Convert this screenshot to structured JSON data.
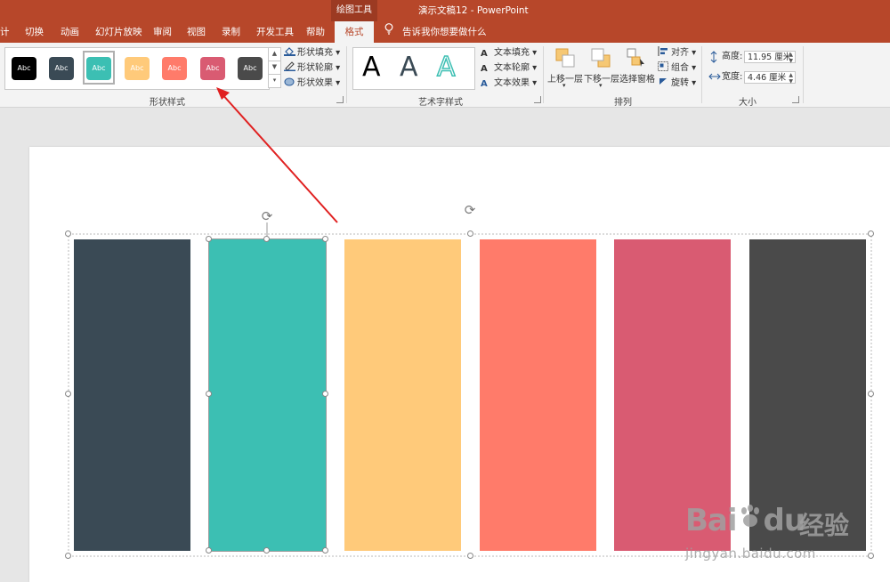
{
  "window": {
    "doc_title": "演示文稿12  -  PowerPoint",
    "context_tool": "绘图工具"
  },
  "tabs": [
    {
      "label": "计"
    },
    {
      "label": "切换"
    },
    {
      "label": "动画"
    },
    {
      "label": "幻灯片放映"
    },
    {
      "label": "审阅"
    },
    {
      "label": "视图"
    },
    {
      "label": "录制"
    },
    {
      "label": "开发工具"
    },
    {
      "label": "帮助"
    }
  ],
  "active_tab": "格式",
  "tell_me": "告诉我你想要做什么",
  "ribbon": {
    "shape_styles": {
      "label": "形状样式",
      "swatch_text": "Abc",
      "swatches": [
        {
          "color": "#000000"
        },
        {
          "color": "#3a4a55"
        },
        {
          "color": "#3cbfb3"
        },
        {
          "color": "#ffca7a"
        },
        {
          "color": "#ff7b6a"
        },
        {
          "color": "#d95b72"
        },
        {
          "color": "#4a4a4a"
        }
      ],
      "fill": "形状填充",
      "outline": "形状轮廓",
      "effects": "形状效果"
    },
    "wordart": {
      "label": "艺术字样式",
      "letter": "A",
      "fill": "文本填充",
      "outline": "文本轮廓",
      "effects": "文本效果"
    },
    "arrange": {
      "label": "排列",
      "bring_forward": "上移一层",
      "send_backward": "下移一层",
      "selection_pane": "选择窗格",
      "align": "对齐",
      "group": "组合",
      "rotate": "旋转"
    },
    "size": {
      "label": "大小",
      "height_label": "高度:",
      "height_value": "11.95 厘米",
      "width_label": "宽度:",
      "width_value": "4.46 厘米"
    }
  },
  "bars": [
    {
      "color": "#3a4a55"
    },
    {
      "color": "#3cbfb3"
    },
    {
      "color": "#ffca7a"
    },
    {
      "color": "#ff7b6a"
    },
    {
      "color": "#d95b72"
    },
    {
      "color": "#4a4a4a"
    }
  ],
  "colors": {
    "titlebar": "#b7472a",
    "annotation_arrow": "#e02020"
  },
  "watermark": {
    "brand": "Bai",
    "brand2": "du",
    "cn": "经验",
    "url": "jingyan.baidu.com"
  }
}
